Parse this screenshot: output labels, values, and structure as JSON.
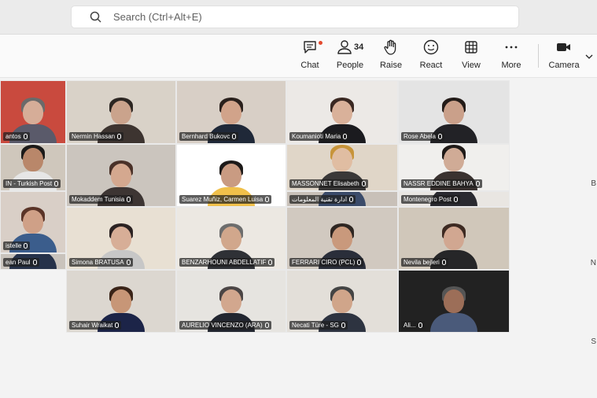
{
  "search": {
    "placeholder": "Search (Ctrl+Alt+E)"
  },
  "toolbar": {
    "chat": "Chat",
    "people": "People",
    "people_count": "34",
    "raise": "Raise",
    "react": "React",
    "view": "View",
    "more": "More",
    "camera": "Camera"
  },
  "participants": [
    "antos",
    "Nermin Hassan",
    "Bernhard Bukovc",
    "Koumanioti Maria",
    "Rose Abela",
    "IN - Turkish Post",
    "Mokaddem Tunisia",
    "Suarez Muñiz, Carmen Luisa",
    "MASSONNET Elisabeth",
    "NASSR EDDINE BAHYA",
    "istelle",
    "Simona BRATUSA",
    "BENZARHOUNI ABDELLATIF",
    "ادارة تقنية المعلومات",
    "Montenegro Post",
    "ean Paul",
    "Suhair Wraikat",
    "AURELIO VINCENZO (ARA)",
    "FERRARI CIRO (PCL)",
    "Nevila bejleri",
    "Necati Türe - SG",
    "Ali..."
  ],
  "side_letters": [
    "B",
    "N",
    "S"
  ]
}
